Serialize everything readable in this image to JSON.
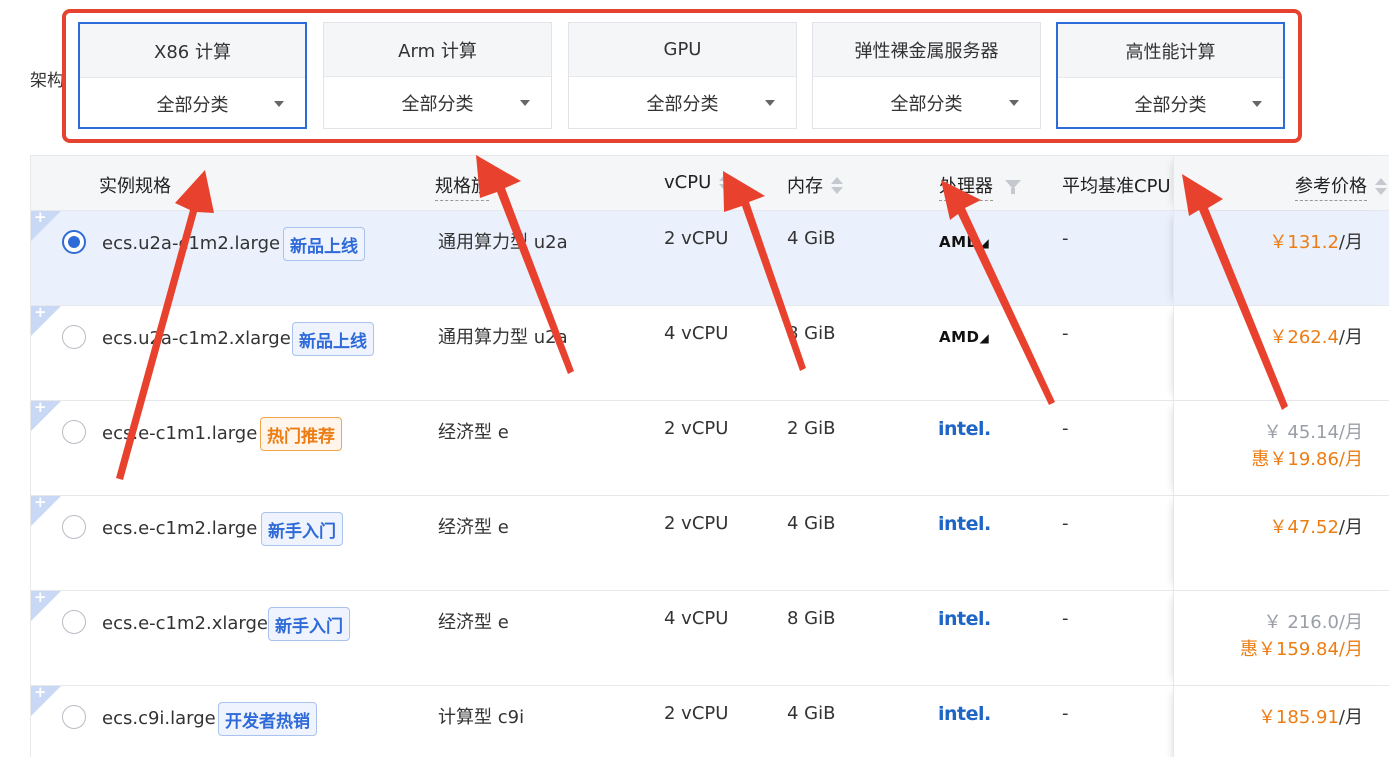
{
  "arch_label": "架构",
  "tabs": [
    {
      "title": "X86 计算",
      "select": "全部分类",
      "active": true
    },
    {
      "title": "Arm 计算",
      "select": "全部分类",
      "active": false
    },
    {
      "title": "GPU",
      "select": "全部分类",
      "active": false
    },
    {
      "title": "弹性裸金属服务器",
      "select": "全部分类",
      "active": false
    },
    {
      "title": "高性能计算",
      "select": "全部分类",
      "active": true
    }
  ],
  "table": {
    "headers": {
      "instance": "实例规格",
      "family": "规格族",
      "vcpu": "vCPU",
      "memory": "内存",
      "processor": "处理器",
      "baseline": "平均基准CPU",
      "price": "参考价格"
    },
    "rows": [
      {
        "spec": "ecs.u2a-c1m2.large",
        "badge": "新品上线",
        "badge_color": "blue",
        "family": "通用算力型 u2a",
        "vcpu": "2 vCPU",
        "memory": "4 GiB",
        "processor": "AMD",
        "baseline": "-",
        "price": "￥131.2",
        "unit": "/月",
        "promo": "",
        "selected": true
      },
      {
        "spec": "ecs.u2a-c1m2.xlarge",
        "badge": "新品上线",
        "badge_color": "blue",
        "family": "通用算力型 u2a",
        "vcpu": "4 vCPU",
        "memory": "8 GiB",
        "processor": "AMD",
        "baseline": "-",
        "price": "￥262.4",
        "unit": "/月",
        "promo": "",
        "selected": false
      },
      {
        "spec": "ecs.e-c1m1.large",
        "badge": "热门推荐",
        "badge_color": "orange",
        "family": "经济型 e",
        "vcpu": "2 vCPU",
        "memory": "2 GiB",
        "processor": "intel",
        "baseline": "-",
        "price": "￥ 45.14",
        "unit": "/月",
        "promo": "惠￥19.86/月",
        "selected": false
      },
      {
        "spec": "ecs.e-c1m2.large",
        "badge": "新手入门",
        "badge_color": "blue",
        "family": "经济型 e",
        "vcpu": "2 vCPU",
        "memory": "4 GiB",
        "processor": "intel",
        "baseline": "-",
        "price": "￥47.52",
        "unit": "/月",
        "promo": "",
        "selected": false
      },
      {
        "spec": "ecs.e-c1m2.xlarge",
        "badge": "新手入门",
        "badge_color": "blue",
        "family": "经济型 e",
        "vcpu": "4 vCPU",
        "memory": "8 GiB",
        "processor": "intel",
        "baseline": "-",
        "price": "￥ 216.0",
        "unit": "/月",
        "promo": "惠￥159.84/月",
        "selected": false
      },
      {
        "spec": "ecs.c9i.large",
        "badge": "开发者热销",
        "badge_color": "blue",
        "family": "计算型 c9i",
        "vcpu": "2 vCPU",
        "memory": "4 GiB",
        "processor": "intel",
        "baseline": "-",
        "price": "￥185.91",
        "unit": "/月",
        "promo": "",
        "selected": false
      }
    ]
  },
  "colors": {
    "highlight_box": "#e5422f",
    "accent_blue": "#2f6bd8",
    "price_orange": "#ec7d14",
    "annotation_arrow": "#e8422e"
  }
}
